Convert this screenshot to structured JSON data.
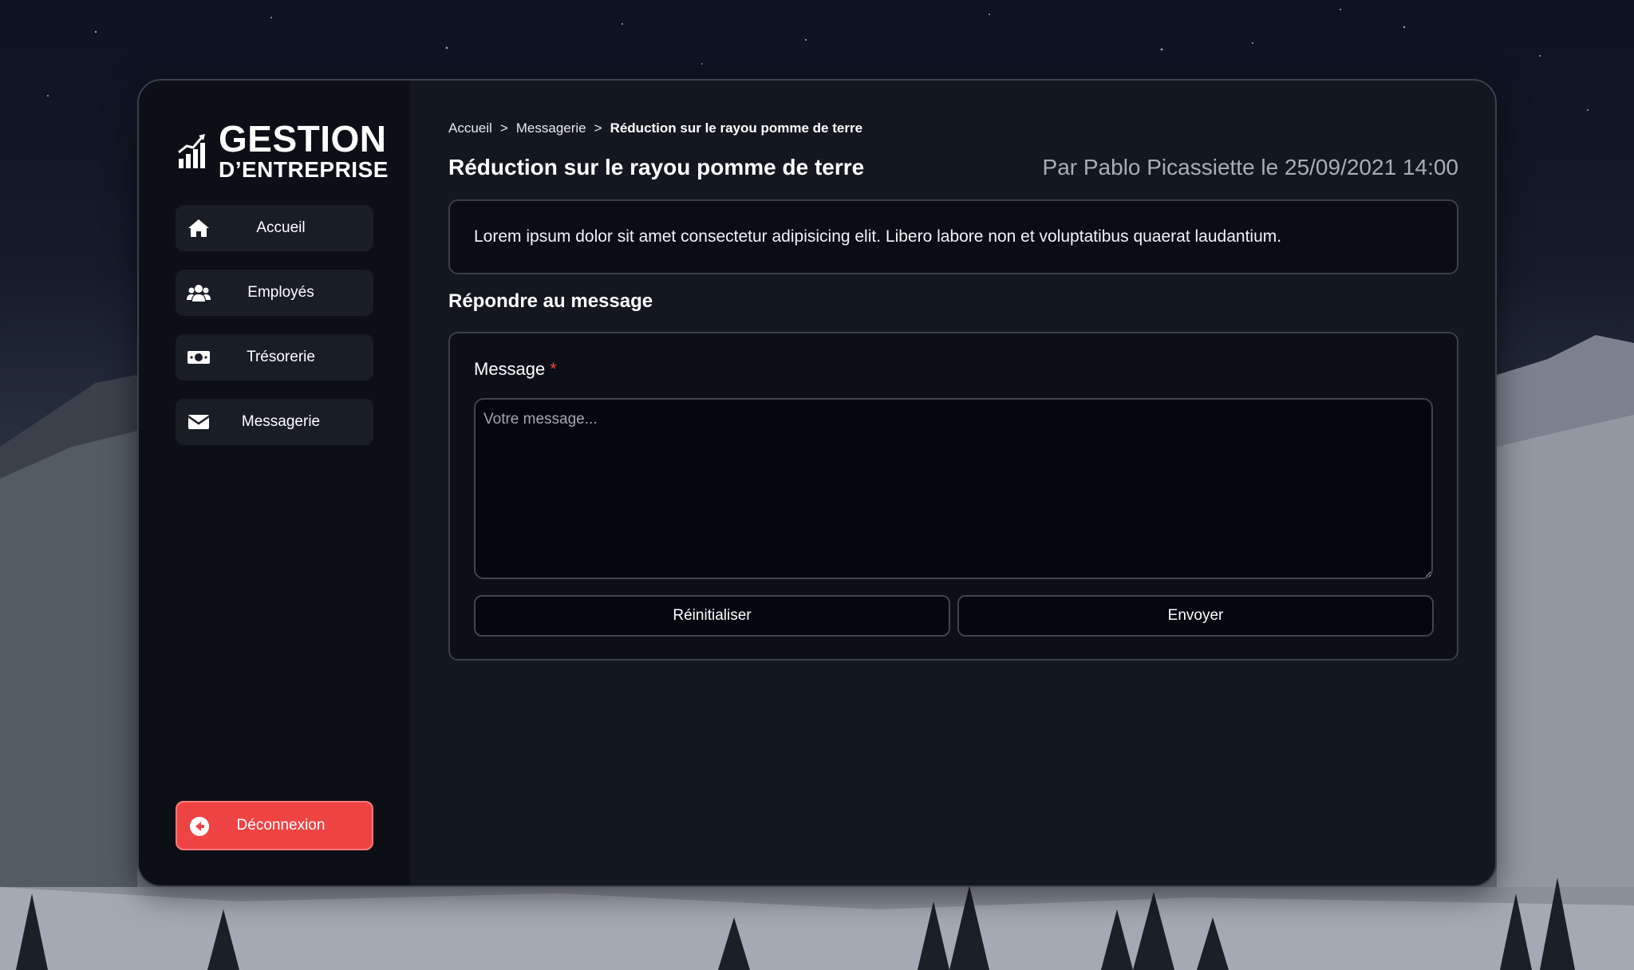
{
  "sidebar": {
    "logo": {
      "line1": "GESTION",
      "line2": "D’ENTREPRISE",
      "icon": "chart-growth-icon"
    },
    "items": [
      {
        "label": "Accueil",
        "icon": "home-icon"
      },
      {
        "label": "Employés",
        "icon": "users-icon"
      },
      {
        "label": "Trésorerie",
        "icon": "money-icon"
      },
      {
        "label": "Messagerie",
        "icon": "envelope-icon"
      }
    ],
    "logout": {
      "label": "Déconnexion",
      "icon": "arrow-left-circle-icon"
    }
  },
  "breadcrumb": {
    "items": [
      "Accueil",
      "Messagerie"
    ],
    "separator": ">",
    "current": "Réduction sur le rayou pomme de terre"
  },
  "message": {
    "title": "Réduction sur le rayou pomme de terre",
    "byline": "Par Pablo Picassiette le 25/09/2021 14:00",
    "body": "Lorem ipsum dolor sit amet consectetur adipisicing elit. Libero labore non et voluptatibus quaerat laudantium."
  },
  "reply": {
    "heading": "Répondre au message",
    "field_label": "Message",
    "required_mark": "*",
    "placeholder": "Votre message...",
    "value": "",
    "reset_label": "Réinitialiser",
    "send_label": "Envoyer"
  },
  "colors": {
    "accent_danger": "#ee4444",
    "panel_bg": "#121720",
    "sidebar_bg": "#0c0f16"
  }
}
